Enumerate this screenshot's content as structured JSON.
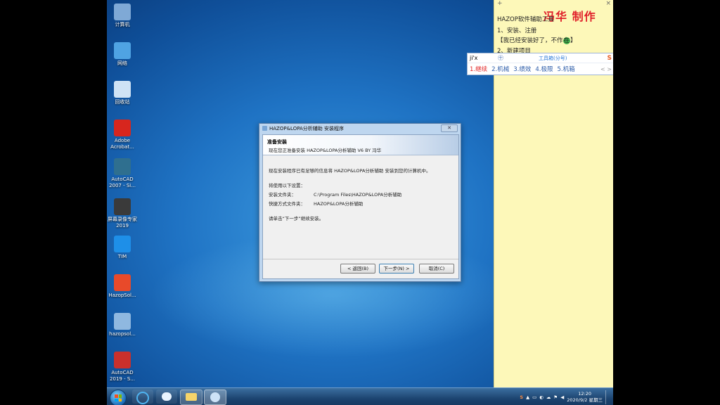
{
  "desktop": {
    "icons": [
      {
        "name": "computer-icon",
        "label": "计算机",
        "color": "#7fa9d6"
      },
      {
        "name": "network-icon",
        "label": "网络",
        "color": "#4fa3e3"
      },
      {
        "name": "recycle-bin-icon",
        "label": "回收站",
        "color": "#cfe3f5"
      },
      {
        "name": "adobe-acrobat-icon",
        "label": "Adobe Acrobat...",
        "color": "#d7261e"
      },
      {
        "name": "autocad-2007-icon",
        "label": "AutoCAD 2007 - Si...",
        "color": "#2f6f8f"
      },
      {
        "name": "screen-recorder-icon",
        "label": "屏幕录像专家2019",
        "color": "#3a3a3a"
      },
      {
        "name": "tim-icon",
        "label": "TIM",
        "color": "#1e8fe8"
      },
      {
        "name": "hazop-icon",
        "label": "HazopSol...",
        "color": "#e84a2a"
      },
      {
        "name": "hazop-setup-icon",
        "label": "hazopsol...",
        "color": "#8fb8e0"
      },
      {
        "name": "autocad-2019-icon",
        "label": "AutoCAD 2019 - S...",
        "color": "#c9302c"
      }
    ]
  },
  "sticky_note": {
    "add": "+",
    "close": "×",
    "title": "冯华 制作",
    "lines": [
      "HAZOP软件辅助工具",
      "1、安装、注册",
      "【我已经安装好了，不作",
      "】",
      "2、新建项目"
    ]
  },
  "ime": {
    "input": "ji'x",
    "pin": "㊉",
    "toolbox": "工具箱(分号)",
    "logo": "S",
    "candidates": [
      "1.继续",
      "2.机械",
      "3.绩效",
      "4.极限",
      "5.机箱"
    ],
    "nav": "< >"
  },
  "dialog": {
    "title": "HAZOP&LOPA分析辅助 安装程序",
    "close": "✕",
    "banner_heading": "准备安装",
    "banner_sub": "现在您正准备安装 HAZOP&LOPA分析辅助 V6 BY 冯华",
    "intro": "现在安装程序已有足够的信息将 HAZOP&LOPA分析辅助 安装到您的计算机中。",
    "settings_heading": "将使用以下设置：",
    "dest_label": "安装文件夹：",
    "dest_value": "C:\\Program Files\\HAZOP&LOPA分析辅助",
    "shortcut_label": "快捷方式文件夹：",
    "shortcut_value": "HAZOP&LOPA分析辅助",
    "continue_text": "请单击“下一步”继续安装。",
    "back_button": "< 返回(B)",
    "next_button": "下一步(N) >",
    "cancel_button": "取消(C)"
  },
  "taskbar": {
    "time": "12:20",
    "date": "2020/9/2 星期三",
    "colors": {
      "start": "#1c6bb7",
      "accent": "#3c6fa0"
    }
  }
}
